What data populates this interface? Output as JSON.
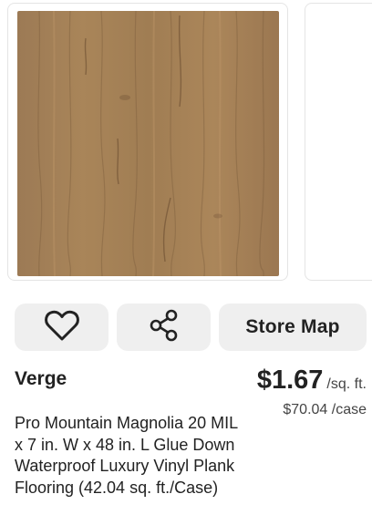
{
  "colors": {
    "button_bg": "#efefef",
    "text": "#222222",
    "wood_base": "#a27e56"
  },
  "product": {
    "image_alt": "Pro Mountain Magnolia vinyl plank wood texture",
    "brand": "Verge",
    "price": "$1.67",
    "price_unit": "/sq. ft.",
    "case_price": "$70.04 /case",
    "title": "Pro Mountain Magnolia 20 MIL x 7 in. W x 48 in. L Glue Down Waterproof Luxury Vinyl Plank Flooring (42.04 sq. ft./Case)"
  },
  "actions": {
    "favorite_icon": "heart-icon",
    "share_icon": "share-icon",
    "store_map_label": "Store Map"
  }
}
